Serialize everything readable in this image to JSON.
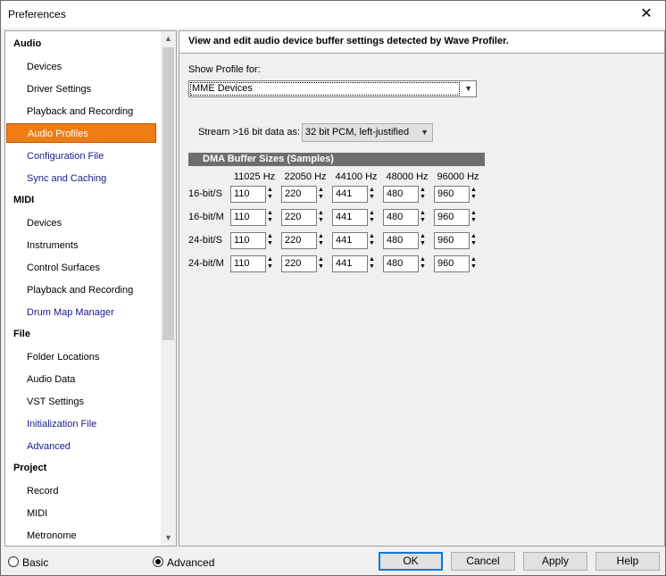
{
  "window": {
    "title": "Preferences",
    "close_glyph": "✕"
  },
  "nav": {
    "sections": [
      {
        "label": "Audio",
        "items": [
          {
            "label": "Devices",
            "style": "normal"
          },
          {
            "label": "Driver Settings",
            "style": "normal"
          },
          {
            "label": "Playback and Recording",
            "style": "normal"
          },
          {
            "label": "Audio Profiles",
            "style": "selected"
          },
          {
            "label": "Configuration File",
            "style": "blue"
          },
          {
            "label": "Sync and Caching",
            "style": "blue"
          }
        ]
      },
      {
        "label": "MIDI",
        "items": [
          {
            "label": "Devices",
            "style": "normal"
          },
          {
            "label": "Instruments",
            "style": "normal"
          },
          {
            "label": "Control Surfaces",
            "style": "normal"
          },
          {
            "label": "Playback and Recording",
            "style": "normal"
          },
          {
            "label": "Drum Map Manager",
            "style": "blue"
          }
        ]
      },
      {
        "label": "File",
        "items": [
          {
            "label": "Folder Locations",
            "style": "normal"
          },
          {
            "label": "Audio Data",
            "style": "normal"
          },
          {
            "label": "VST Settings",
            "style": "normal"
          },
          {
            "label": "Initialization File",
            "style": "blue"
          },
          {
            "label": "Advanced",
            "style": "blue"
          }
        ]
      },
      {
        "label": "Project",
        "items": [
          {
            "label": "Record",
            "style": "normal"
          },
          {
            "label": "MIDI",
            "style": "normal"
          },
          {
            "label": "Metronome",
            "style": "normal"
          }
        ]
      }
    ]
  },
  "content": {
    "banner": "View and edit audio device buffer settings detected by Wave Profiler.",
    "show_profile_label": "Show Profile for:",
    "show_profile_value": "MME Devices",
    "stream_label": "Stream >16 bit data as:",
    "stream_value": "32 bit PCM, left-justified",
    "dma_header": "DMA Buffer Sizes (Samples)",
    "columns": [
      "11025 Hz",
      "22050 Hz",
      "44100 Hz",
      "48000 Hz",
      "96000 Hz"
    ],
    "rows": [
      {
        "label": "16-bit/S",
        "values": [
          "110",
          "220",
          "441",
          "480",
          "960"
        ]
      },
      {
        "label": "16-bit/M",
        "values": [
          "110",
          "220",
          "441",
          "480",
          "960"
        ]
      },
      {
        "label": "24-bit/S",
        "values": [
          "110",
          "220",
          "441",
          "480",
          "960"
        ]
      },
      {
        "label": "24-bit/M",
        "values": [
          "110",
          "220",
          "441",
          "480",
          "960"
        ]
      }
    ]
  },
  "footer": {
    "basic_label": "Basic",
    "advanced_label": "Advanced",
    "selected_mode": "Advanced",
    "ok_label": "OK",
    "cancel_label": "Cancel",
    "apply_label": "Apply",
    "help_label": "Help"
  },
  "colors": {
    "selection": "#f07d14",
    "link_blue": "#1a1a8c",
    "dma_header_bg": "#6e6e6e",
    "default_button_border": "#0078d7"
  }
}
